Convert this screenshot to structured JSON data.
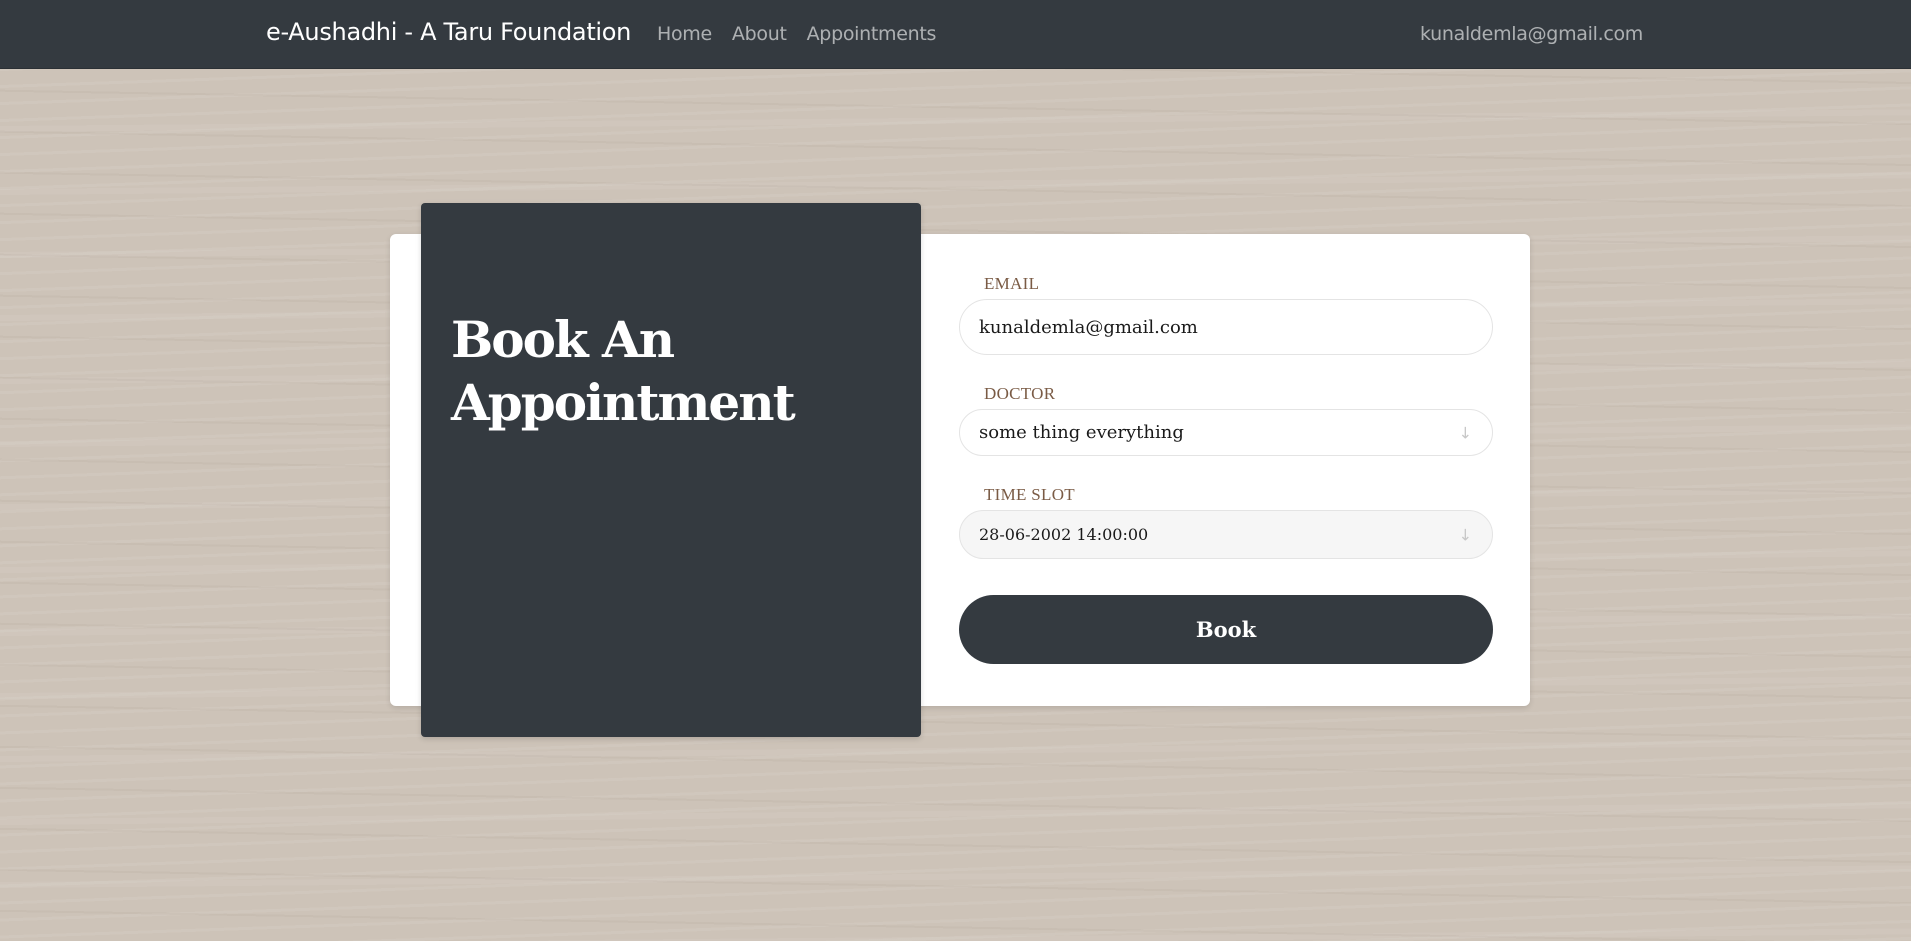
{
  "navbar": {
    "brand": "e-Aushadhi - A Taru Foundation",
    "links": [
      "Home",
      "About",
      "Appointments"
    ],
    "user_email": "kunaldemla@gmail.com"
  },
  "panel": {
    "title": "Book An Appointment"
  },
  "form": {
    "email_label": "EMAIL",
    "email_value": "kunaldemla@gmail.com",
    "doctor_label": "DOCTOR",
    "doctor_value": "some thing everything",
    "timeslot_label": "TIME SLOT",
    "timeslot_value": "28-06-2002 14:00:00",
    "submit_label": "Book",
    "dropdown_icon": "arrow-down-icon"
  },
  "colors": {
    "navbar_bg": "#343a40",
    "panel_bg": "#343a40",
    "button_bg": "#343a40",
    "label_color": "#7a5b45",
    "card_bg": "#ffffff",
    "page_bg": "#cdc3b8"
  }
}
